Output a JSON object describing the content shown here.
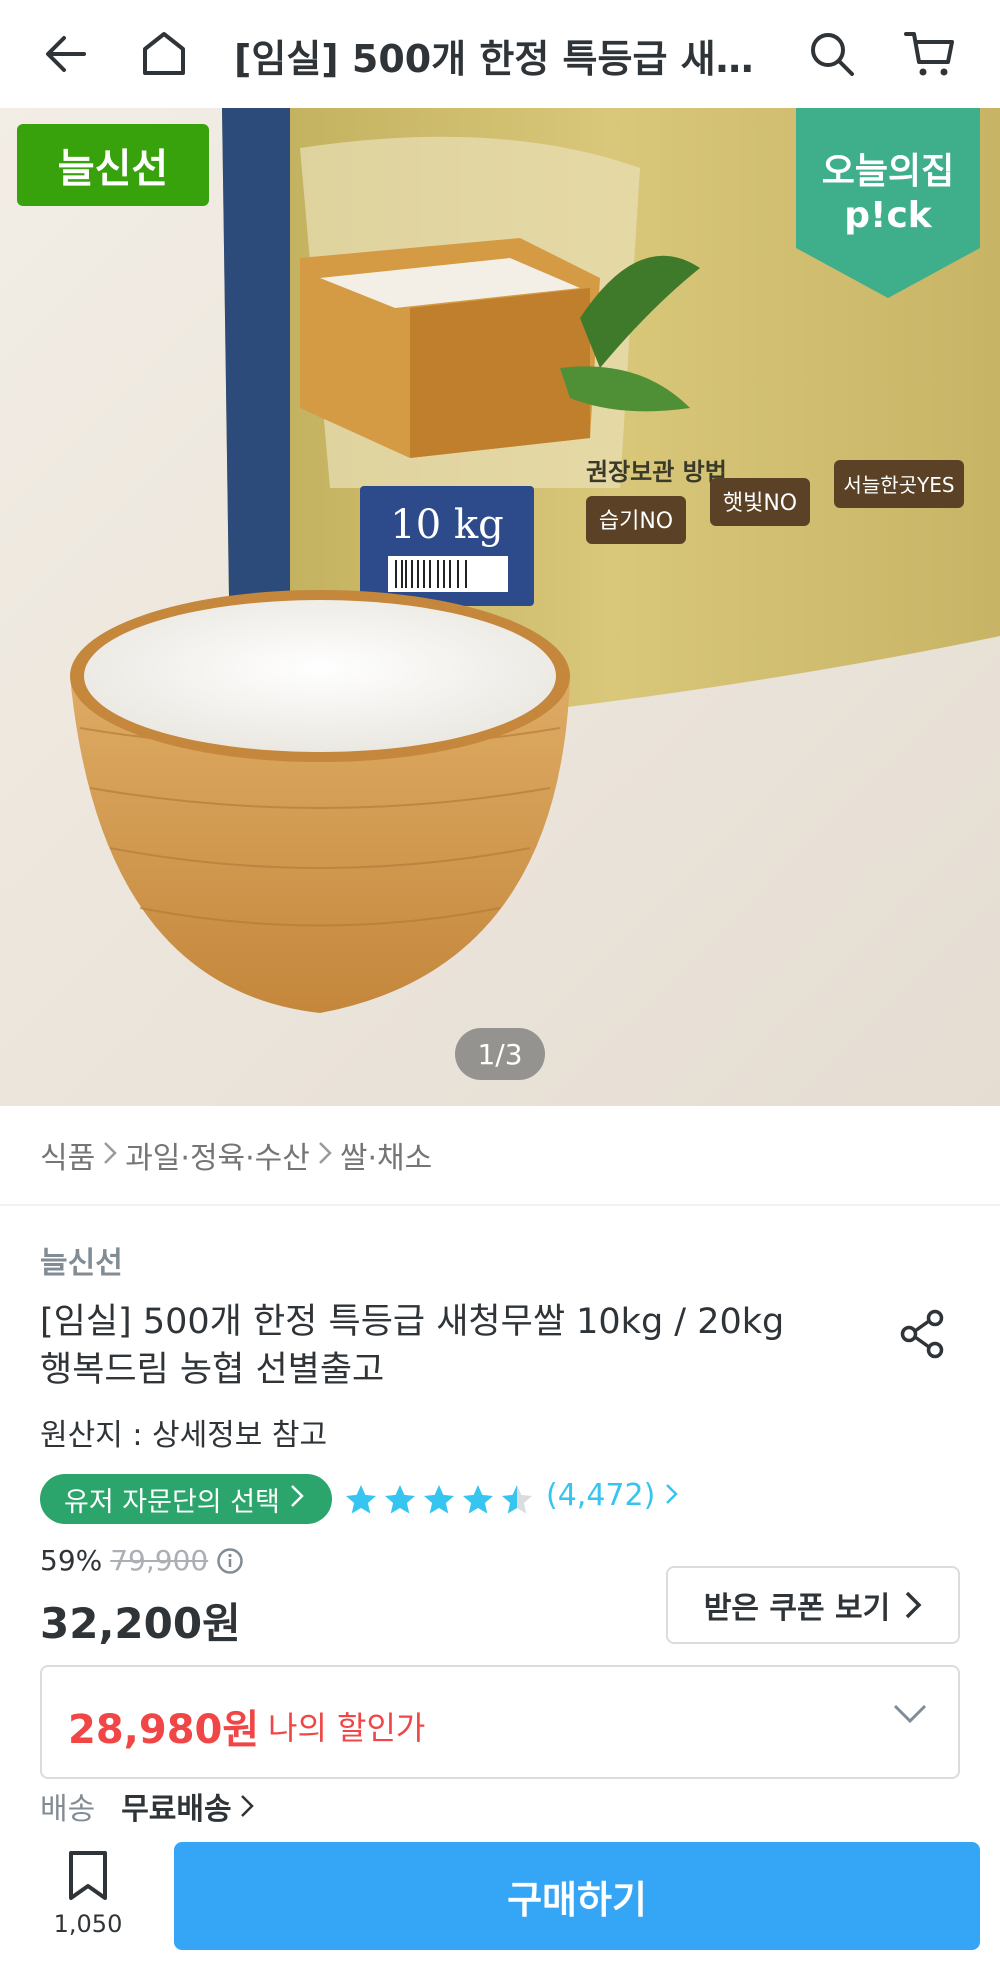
{
  "header": {
    "title": "[임실] 500개 한정 특등급 새…",
    "back_icon": "arrow-left-icon",
    "home_icon": "home-icon",
    "search_icon": "search-icon",
    "cart_icon": "cart-icon"
  },
  "hero": {
    "badge_left": "늘신선",
    "badge_right_line1": "오늘의집",
    "badge_right_line2": "p!ck",
    "pager": "1/3",
    "bag_weight": "10 kg",
    "bag_caption": "권장보관 방법",
    "bag_tag1": "습기NO",
    "bag_tag2": "햇빛NO",
    "bag_tag3": "서늘한곳YES"
  },
  "breadcrumb": [
    "식품",
    "과일·정육·수산",
    "쌀·채소"
  ],
  "product": {
    "brand": "늘신선",
    "title_line1": "[임실] 500개 한정 특등급 새청무쌀 10kg / 20kg",
    "title_line2": "행복드림 농협 선별출고",
    "origin": "원산지 : 상세정보 참고",
    "user_pick": "유저 자문단의 선택",
    "rating": 4.5,
    "review_count": "(4,472)",
    "discount_rate": "59%",
    "original_price": "79,900",
    "price": "32,200원",
    "coupon_button": "받은 쿠폰 보기",
    "my_price": "28,980원",
    "my_price_label": "나의 할인가",
    "shipping_label": "배송",
    "shipping_value": "무료배송"
  },
  "bottom": {
    "bookmark_count": "1,050",
    "buy_button": "구매하기"
  },
  "colors": {
    "green_badge": "#38a20c",
    "pick_badge": "#3fae8a",
    "user_pick": "#2ba56b",
    "star": "#35c5f0",
    "sale_red": "#f04646",
    "buy_blue": "#35a6f5"
  }
}
